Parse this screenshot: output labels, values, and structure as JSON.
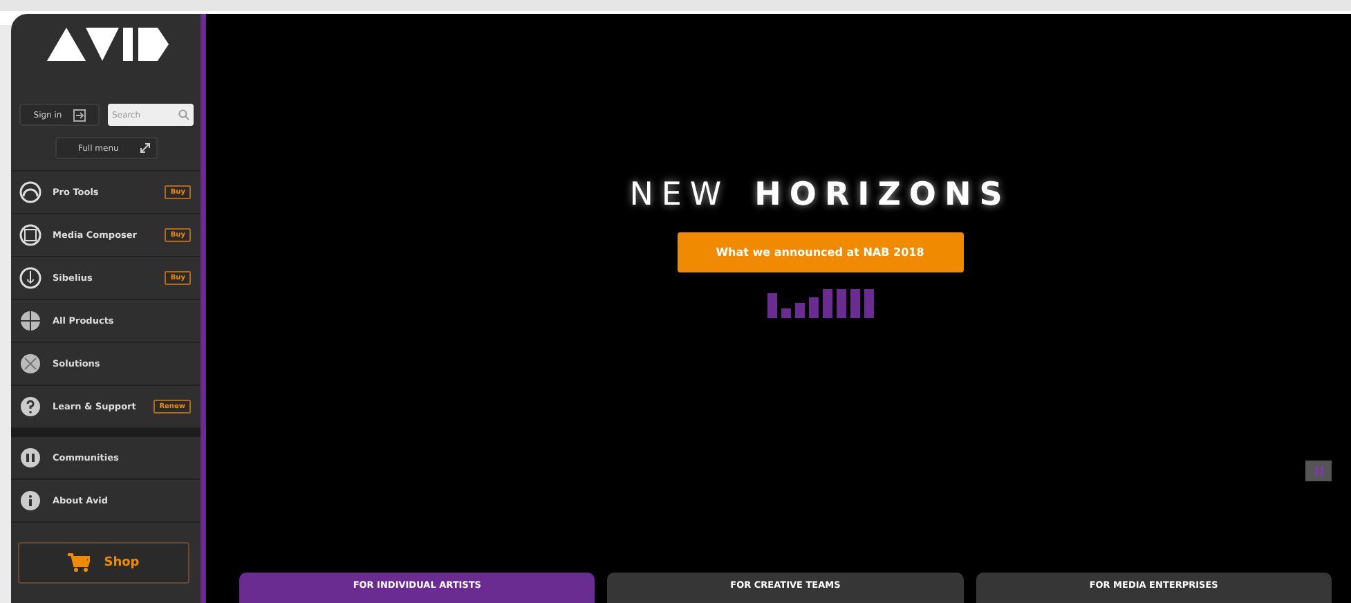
{
  "sidebar": {
    "sign_in": "Sign in",
    "search": {
      "placeholder": "Search"
    },
    "full_menu": "Full menu",
    "items": [
      {
        "label": "Pro Tools",
        "badge": "Buy"
      },
      {
        "label": "Media Composer",
        "badge": "Buy"
      },
      {
        "label": "Sibelius",
        "badge": "Buy"
      },
      {
        "label": "All Products"
      },
      {
        "label": "Solutions"
      },
      {
        "label": "Learn & Support",
        "badge": "Renew"
      }
    ],
    "more_items": [
      {
        "label": "Communities"
      },
      {
        "label": "About Avid"
      }
    ],
    "shop": "Shop"
  },
  "hero": {
    "title_light": "NEW",
    "title_bold": "HORIZONS",
    "cta": "What we announced at NAB 2018"
  },
  "tabs": [
    {
      "label": "FOR INDIVIDUAL ARTISTS",
      "selected": true
    },
    {
      "label": "FOR CREATIVE TEAMS",
      "selected": false
    },
    {
      "label": "FOR MEDIA ENTERPRISES",
      "selected": false
    }
  ]
}
